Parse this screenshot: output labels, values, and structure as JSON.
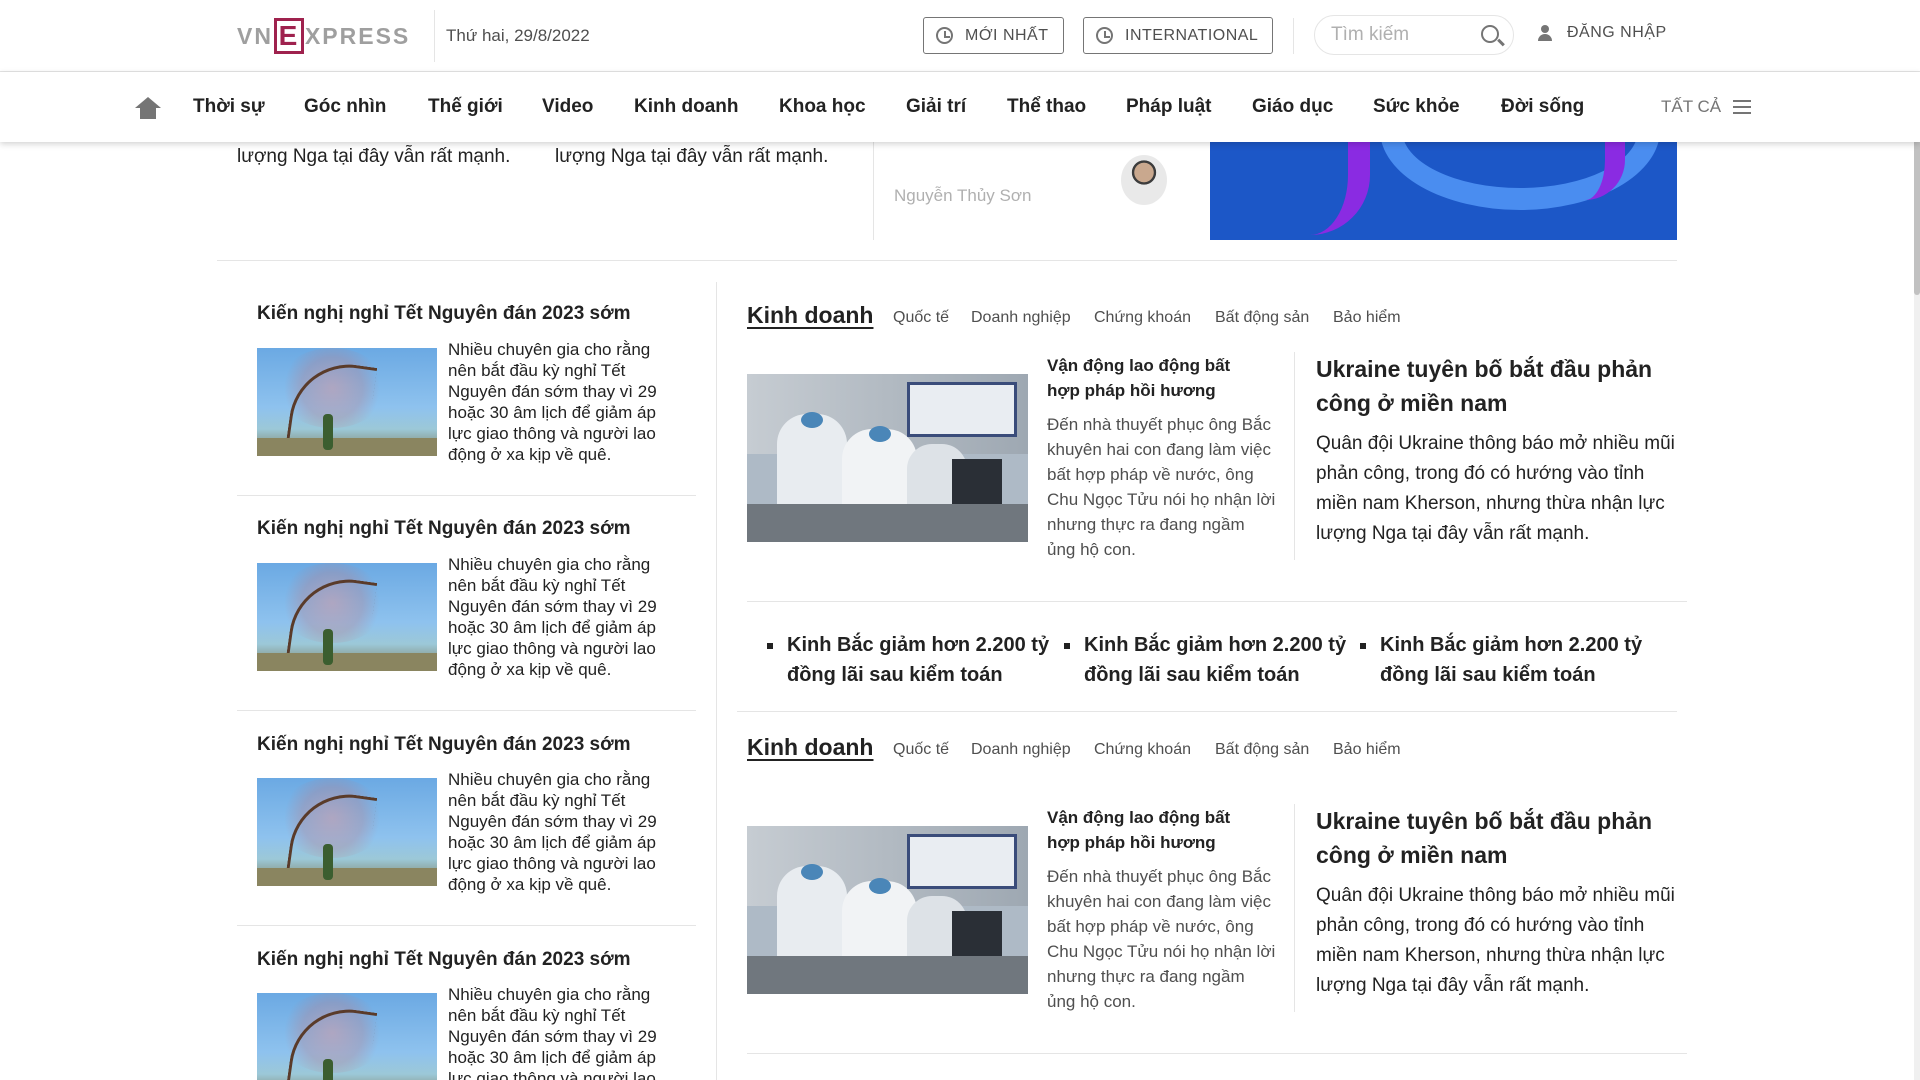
{
  "header": {
    "logo": {
      "pre": "VN",
      "mark": "E",
      "post": "XPRESS"
    },
    "date": "Thứ hai, 29/8/2022",
    "latest_label": "MỚI NHẤT",
    "international_label": "INTERNATIONAL",
    "search_placeholder": "Tìm kiếm",
    "login_label": "ĐĂNG NHẬP"
  },
  "nav": {
    "items": [
      "Thời sự",
      "Góc nhìn",
      "Thế giới",
      "Video",
      "Kinh doanh",
      "Khoa học",
      "Giải trí",
      "Thể thao",
      "Pháp luật",
      "Giáo dục",
      "Sức khỏe",
      "Đời sống"
    ],
    "all_label": "TẤT CẢ"
  },
  "top_partial": {
    "text_a": "lượng Nga tại đây vẫn rất mạnh.",
    "text_b": "lượng Nga tại đây vẫn rất mạnh.",
    "author": "Nguyễn Thủy Sơn"
  },
  "left_list": [
    {
      "title": "Kiến nghị nghỉ Tết Nguyên đán 2023 sớm",
      "desc": "Nhiều chuyên gia cho rằng nên bắt đầu kỳ nghỉ Tết Nguyên đán sớm thay vì 29 hoặc 30 âm lịch để giảm áp lực giao thông và người lao động ở xa kịp về quê."
    },
    {
      "title": "Kiến nghị nghỉ Tết Nguyên đán 2023 sớm",
      "desc": "Nhiều chuyên gia cho rằng nên bắt đầu kỳ nghỉ Tết Nguyên đán sớm thay vì 29 hoặc 30 âm lịch để giảm áp lực giao thông và người lao động ở xa kịp về quê."
    },
    {
      "title": "Kiến nghị nghỉ Tết Nguyên đán 2023 sớm",
      "desc": "Nhiều chuyên gia cho rằng nên bắt đầu kỳ nghỉ Tết Nguyên đán sớm thay vì 29 hoặc 30 âm lịch để giảm áp lực giao thông và người lao động ở xa kịp về quê."
    },
    {
      "title": "Kiến nghị nghỉ Tết Nguyên đán 2023 sớm",
      "desc": "Nhiều chuyên gia cho rằng nên bắt đầu kỳ nghỉ Tết Nguyên đán sớm thay vì 29 hoặc 30 âm lịch để giảm áp lực giao thông và người lao"
    }
  ],
  "sections": [
    {
      "title": "Kinh doanh",
      "subs": [
        "Quốc tế",
        "Doanh nghiệp",
        "Chứng khoán",
        "Bất động sản",
        "Bảo hiểm"
      ],
      "small_title": "Vận động lao động bất hợp pháp hồi hương",
      "small_desc": "Đến nhà thuyết phục ông Bắc khuyên hai con đang làm việc bất hợp pháp về nước, ông Chu Ngọc Tửu nói họ nhận lời nhưng thực ra đang ngầm ủng hộ con.",
      "big_title": "Ukraine tuyên bố bắt đầu phản công ở miền nam",
      "big_desc": "Quân đội Ukraine thông báo mở nhiều mũi phản công, trong đó có hướng vào tỉnh miền nam Kherson, nhưng thừa nhận lực lượng Nga tại đây vẫn rất mạnh.",
      "bullets": [
        "Kinh Bắc giảm hơn 2.200 tỷ đồng lãi sau kiểm toán",
        "Kinh Bắc giảm hơn 2.200 tỷ đồng lãi sau kiểm toán",
        "Kinh Bắc giảm hơn 2.200 tỷ đồng lãi sau kiểm toán"
      ]
    },
    {
      "title": "Kinh doanh",
      "subs": [
        "Quốc tế",
        "Doanh nghiệp",
        "Chứng khoán",
        "Bất động sản",
        "Bảo hiểm"
      ],
      "small_title": "Vận động lao động bất hợp pháp hồi hương",
      "small_desc": "Đến nhà thuyết phục ông Bắc khuyên hai con đang làm việc bất hợp pháp về nước, ông Chu Ngọc Tửu nói họ nhận lời nhưng thực ra đang ngầm ủng hộ con.",
      "big_title": "Ukraine tuyên bố bắt đầu phản công ở miền nam",
      "big_desc": "Quân đội Ukraine thông báo mở nhiều mũi phản công, trong đó có hướng vào tỉnh miền nam Kherson, nhưng thừa nhận lực lượng Nga tại đây vẫn rất mạnh."
    }
  ],
  "icons": {
    "clock": "clock-icon",
    "search": "search-icon",
    "user": "user-icon",
    "home": "home-icon",
    "menu": "menu-icon"
  },
  "colors": {
    "brand": "#9f224e",
    "text": "#222222",
    "muted": "#757575",
    "divider": "#e5e5e5"
  }
}
